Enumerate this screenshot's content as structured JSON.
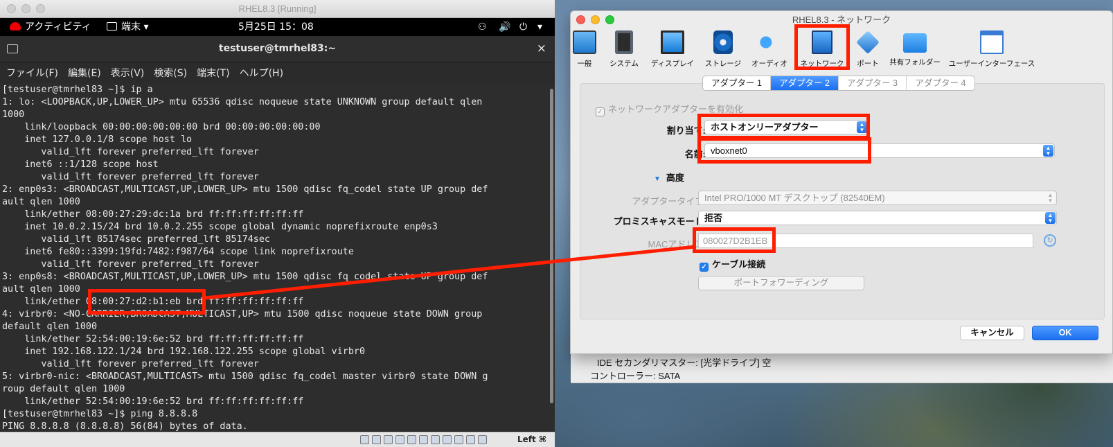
{
  "vm_window": {
    "title": "RHEL8.3 [Running]",
    "gnome_bar": {
      "activities": "アクティビティ",
      "app_menu": "端末 ▾",
      "clock": "5月25日  15：08"
    },
    "terminal": {
      "title": "testuser@tmrhel83:~",
      "close": "×",
      "menu": [
        "ファイル(F)",
        "編集(E)",
        "表示(V)",
        "検索(S)",
        "端末(T)",
        "ヘルプ(H)"
      ],
      "lines": [
        "[testuser@tmrhel83 ~]$ ip a",
        "1: lo: <LOOPBACK,UP,LOWER_UP> mtu 65536 qdisc noqueue state UNKNOWN group default qlen",
        "1000",
        "    link/loopback 00:00:00:00:00:00 brd 00:00:00:00:00:00",
        "    inet 127.0.0.1/8 scope host lo",
        "       valid_lft forever preferred_lft forever",
        "    inet6 ::1/128 scope host",
        "       valid_lft forever preferred_lft forever",
        "2: enp0s3: <BROADCAST,MULTICAST,UP,LOWER_UP> mtu 1500 qdisc fq_codel state UP group def",
        "ault qlen 1000",
        "    link/ether 08:00:27:29:dc:1a brd ff:ff:ff:ff:ff:ff",
        "    inet 10.0.2.15/24 brd 10.0.2.255 scope global dynamic noprefixroute enp0s3",
        "       valid_lft 85174sec preferred_lft 85174sec",
        "    inet6 fe80::3399:19fd:7482:f987/64 scope link noprefixroute",
        "       valid_lft forever preferred_lft forever",
        "3: enp0s8: <BROADCAST,MULTICAST,UP,LOWER_UP> mtu 1500 qdisc fq_codel state UP group def",
        "ault qlen 1000",
        "    link/ether 08:00:27:d2:b1:eb brd ff:ff:ff:ff:ff:ff",
        "4: virbr0: <NO-CARRIER,BROADCAST,MULTICAST,UP> mtu 1500 qdisc noqueue state DOWN group",
        "default qlen 1000",
        "    link/ether 52:54:00:19:6e:52 brd ff:ff:ff:ff:ff:ff",
        "    inet 192.168.122.1/24 brd 192.168.122.255 scope global virbr0",
        "       valid_lft forever preferred_lft forever",
        "5: virbr0-nic: <BROADCAST,MULTICAST> mtu 1500 qdisc fq_codel master virbr0 state DOWN g",
        "roup default qlen 1000",
        "    link/ether 52:54:00:19:6e:52 brd ff:ff:ff:ff:ff:ff",
        "[testuser@tmrhel83 ~]$ ping 8.8.8.8",
        "PING 8.8.8.8 (8.8.8.8) 56(84) bytes of data."
      ]
    },
    "status_bar": {
      "host_key": "Left ⌘"
    }
  },
  "dialog": {
    "title": "RHEL8.3 - ネットワーク",
    "toolbar": [
      {
        "label": "一般",
        "icon": "general-icon"
      },
      {
        "label": "システム",
        "icon": "system-icon"
      },
      {
        "label": "ディスプレイ",
        "icon": "display-icon"
      },
      {
        "label": "ストレージ",
        "icon": "storage-icon"
      },
      {
        "label": "オーディオ",
        "icon": "audio-icon"
      },
      {
        "label": "ネットワーク",
        "icon": "network-icon"
      },
      {
        "label": "ポート",
        "icon": "port-icon"
      },
      {
        "label": "共有フォルダー",
        "icon": "shared-folder-icon"
      },
      {
        "label": "ユーザーインターフェース",
        "icon": "user-interface-icon"
      }
    ],
    "tabs": [
      "アダプター 1",
      "アダプター 2",
      "アダプター 3",
      "アダプター 4"
    ],
    "enable_adapter": "ネットワークアダプターを有効化",
    "attached_to": {
      "label": "割り当て:",
      "value": "ホストオンリーアダプター"
    },
    "name": {
      "label": "名前:",
      "value": "vboxnet0"
    },
    "advanced": "高度",
    "adapter_type": {
      "label": "アダプタータイプ:",
      "value": "Intel PRO/1000 MT デスクトップ (82540EM)"
    },
    "promiscuous": {
      "label": "プロミスキャスモード:",
      "value": "拒否"
    },
    "mac": {
      "label": "MACアドレス:",
      "value": "080027D2B1EB"
    },
    "cable": "ケーブル接続",
    "port_forwarding": "ポートフォワーディング",
    "cancel": "キャンセル",
    "ok": "OK"
  },
  "background_window": {
    "lines": [
      "IDE セカンダリマスター:   [光学ドライブ] 空",
      "コントローラー: SATA"
    ]
  },
  "colors": {
    "highlight": "#ff1f00",
    "accent": "#1b6ff0"
  }
}
